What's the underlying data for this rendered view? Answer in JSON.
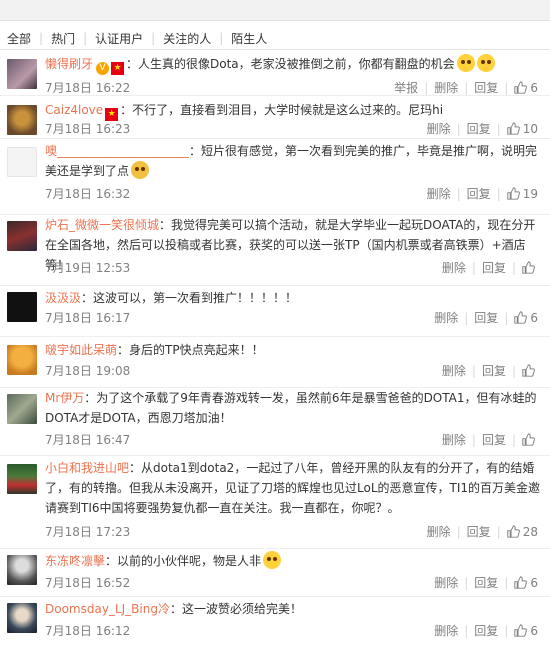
{
  "filters": [
    "全部",
    "热门",
    "认证用户",
    "关注的人",
    "陌生人"
  ],
  "actions": {
    "report": "举报",
    "delete": "删除",
    "reply": "回复"
  },
  "comments": [
    {
      "user": "懒得刷牙",
      "text": "：人生真的很像Dota，老家没被推倒之前，你都有翻盘的机会",
      "date": "7月18日 16:22",
      "likes": "6",
      "report": true
    },
    {
      "user": "Caiz4love",
      "text": "：不行了，直接看到泪目，大学时候就是这么过来的。尼玛hi",
      "date": "7月18日 16:23",
      "likes": "10",
      "report": false
    },
    {
      "user": "噢______________________",
      "text": "：短片很有感觉，第一次看到完美的推广，毕竟是推广啊，说明完美还是学到了点",
      "date": "7月18日 16:32",
      "likes": "19",
      "report": false
    },
    {
      "user": "炉石_微微一笑很倾城",
      "text": "：我觉得完美可以搞个活动，就是大学毕业一起玩DOATA的，现在分开在全国各地，然后可以投稿或者比赛，获奖的可以送一张TP（国内机票或者高铁票）+酒店等！",
      "date": "7月19日 12:53",
      "likes": "",
      "report": false
    },
    {
      "user": "汲汲汲",
      "text": "：这波可以，第一次看到推广！！！！！",
      "date": "7月18日 16:17",
      "likes": "6",
      "report": false
    },
    {
      "user": "啵宇如此呆萌",
      "text": "：身后的TP快点亮起来！！",
      "date": "7月18日 19:08",
      "likes": "",
      "report": false
    },
    {
      "user": "Mr伊万",
      "text": "：为了这个承载了9年青春游戏转一发，虽然前6年是暴雪爸爸的DOTA1，但有冰蛙的DOTA才是DOTA，西恩刀塔加油！",
      "date": "7月18日 16:47",
      "likes": "",
      "report": false
    },
    {
      "user": "小白和我进山吧",
      "text": "：从dota1到dota2，一起过了八年，曾经开黑的队友有的分开了，有的结婚了，有的转撸。但我从未没离开，见证了刀塔的辉煌也见过LoL的恶意宣传，TI1的百万美金邀请赛到TI6中国将要强势复仇都一直在关注。我一直都在，你呢？。",
      "date": "7月18日 17:23",
      "likes": "28",
      "report": false
    },
    {
      "user": "东冻咚凛擊",
      "text": "：以前的小伙伴呢，物是人非",
      "date": "7月18日 16:52",
      "likes": "6",
      "report": false
    },
    {
      "user": "Doomsday_LJ_Bing冷",
      "text": "：这一波赞必须给完美！",
      "date": "7月18日 16:12",
      "likes": "6",
      "report": false
    }
  ]
}
